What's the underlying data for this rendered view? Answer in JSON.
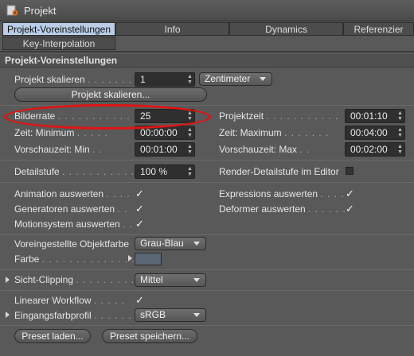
{
  "window": {
    "title": "Projekt",
    "icon": "project-gear-icon"
  },
  "tabs": [
    {
      "label": "Projekt-Voreinstellungen",
      "active": true
    },
    {
      "label": "Info",
      "active": false
    },
    {
      "label": "Dynamics",
      "active": false
    },
    {
      "label": "Referenzier",
      "active": false
    },
    {
      "label": "Key-Interpolation",
      "active": false
    }
  ],
  "section": {
    "title": "Projekt-Voreinstellungen"
  },
  "scale": {
    "label": "Projekt skalieren",
    "value": "1",
    "unit": "Zentimeter",
    "button": "Projekt skalieren..."
  },
  "framerate": {
    "label": "Bilderrate",
    "value": "25"
  },
  "projecttime": {
    "label": "Projektzeit",
    "value": "00:01:10"
  },
  "time_min": {
    "label": "Zeit: Minimum",
    "value": "00:00:00"
  },
  "time_max": {
    "label": "Zeit: Maximum",
    "value": "00:04:00"
  },
  "preview_min": {
    "label": "Vorschauzeit: Min",
    "value": "00:01:00"
  },
  "preview_max": {
    "label": "Vorschauzeit: Max",
    "value": "00:02:00"
  },
  "detail": {
    "label": "Detailstufe",
    "value": "100 %",
    "render_label": "Render-Detailstufe im Editor",
    "render_checked": false
  },
  "checks": {
    "animation": {
      "label": "Animation auswerten",
      "checked": true
    },
    "expressions": {
      "label": "Expressions auswerten",
      "checked": true
    },
    "generators": {
      "label": "Generatoren auswerten",
      "checked": true
    },
    "deformers": {
      "label": "Deformer auswerten",
      "checked": true
    },
    "motion": {
      "label": "Motionsystem auswerten",
      "checked": true
    }
  },
  "objcolor": {
    "label": "Voreingestellte Objektfarbe",
    "value": "Grau-Blau"
  },
  "color": {
    "label": "Farbe",
    "swatch": "#5b6674"
  },
  "clipping": {
    "label": "Sicht-Clipping",
    "value": "Mittel"
  },
  "linear": {
    "label": "Linearer Workflow",
    "checked": true
  },
  "profile": {
    "label": "Eingangsfarbprofil",
    "value": "sRGB"
  },
  "buttons": {
    "load": "Preset laden...",
    "save": "Preset speichern..."
  },
  "check_glyph": "✓",
  "colors": {
    "tab_active": "#b9cde6",
    "panel": "#595959",
    "field": "#2f2f2f",
    "highlight_ellipse": "#e01414"
  }
}
